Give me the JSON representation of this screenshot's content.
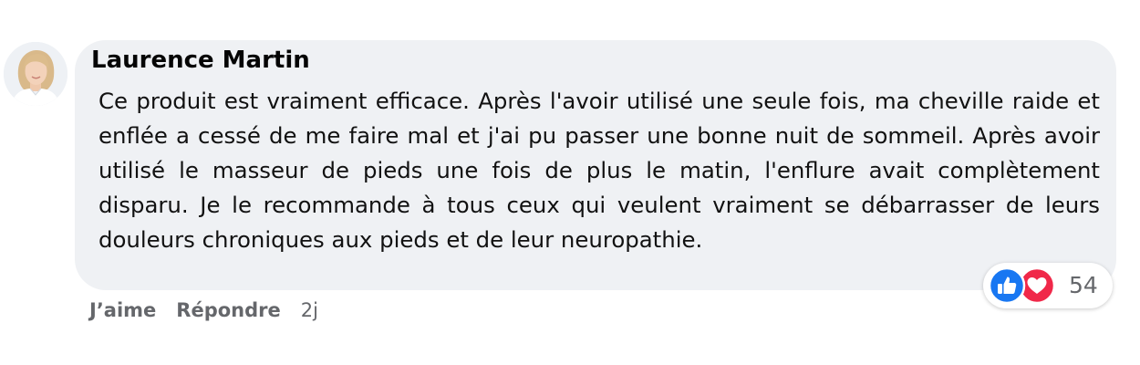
{
  "comment": {
    "author": "Laurence Martin",
    "text": "Ce produit est vraiment efficace. Après l'avoir utilisé une seule fois, ma cheville raide et enflée a cessé de me faire mal et j'ai pu passer une bonne nuit de sommeil. Après avoir utilisé le masseur de pieds une fois de plus le matin, l'enflure avait complètement disparu. Je le recommande à tous ceux qui veulent vraiment se débarrasser de leurs douleurs chroniques aux pieds et de leur neuropathie."
  },
  "reactions": {
    "icons": [
      "like-icon",
      "love-icon"
    ],
    "count": "54"
  },
  "actions": {
    "like_label": "J’aime",
    "reply_label": "Répondre",
    "timestamp": "2j"
  },
  "colors": {
    "bubble_background": "#eff1f4",
    "like_blue": "#1877f2",
    "love_red": "#f02849",
    "meta_gray": "#65676b"
  }
}
